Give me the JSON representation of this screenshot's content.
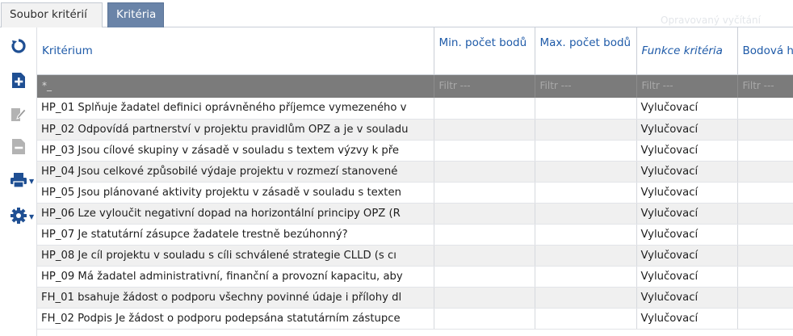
{
  "tabs": [
    {
      "label": "Soubor kritérií",
      "active": false
    },
    {
      "label": "Kritéria",
      "active": true
    }
  ],
  "tab_area_hint": "Opravovaný vyčítání",
  "toolbar": {
    "icons": [
      "refresh-icon",
      "add-document-icon",
      "edit-document-icon",
      "remove-document-icon",
      "print-icon",
      "settings-icon"
    ]
  },
  "colors": {
    "accent": "#1e5aa8",
    "active_tab": "#6a84a8",
    "filter_bar": "#7b7b7b",
    "row_alt": "#f0f0f0"
  },
  "table": {
    "columns": [
      "Kritérium",
      "Min. počet bodů",
      "Max. počet bodů",
      "Funkce kritéria",
      "Bodová h"
    ],
    "filter_placeholder": "Filtr ---",
    "first_filter_value": "*_",
    "rows": [
      [
        "HP_01 Splňuje žadatel definici oprávněného příjemce vymezeného v",
        "",
        "",
        "Vylučovací",
        ""
      ],
      [
        "HP_02 Odpovídá partnerství v projektu pravidlům OPZ a je v souladu",
        "",
        "",
        "Vylučovací",
        ""
      ],
      [
        "HP_03 Jsou cílové skupiny v zásadě v souladu s textem výzvy k pře",
        "",
        "",
        "Vylučovací",
        ""
      ],
      [
        "HP_04 Jsou celkové způsobilé výdaje projektu v rozmezí stanovené",
        "",
        "",
        "Vylučovací",
        ""
      ],
      [
        "HP_05 Jsou plánované aktivity projektu v zásadě v souladu s texten",
        "",
        "",
        "Vylučovací",
        ""
      ],
      [
        "HP_06 Lze vyloučit negativní dopad na horizontální principy OPZ (R",
        "",
        "",
        "Vylučovací",
        ""
      ],
      [
        "HP_07 Je statutární zásupce žadatele trestně bezúhonný?",
        "",
        "",
        "Vylučovací",
        ""
      ],
      [
        "HP_08 Je cíl projektu v souladu s cíli schválené strategie CLLD (s cı",
        "",
        "",
        "Vylučovací",
        ""
      ],
      [
        "HP_09 Má žadatel administrativní, finanční a provozní kapacitu, aby",
        "",
        "",
        "Vylučovací",
        ""
      ],
      [
        "FH_01 bsahuje žádost o podporu všechny povinné údaje i přílohy dl",
        "",
        "",
        "Vylučovací",
        ""
      ],
      [
        "FH_02 Podpis Je žádost o podporu podepsána statutárním zástupce",
        "",
        "",
        "Vylučovací",
        ""
      ]
    ]
  }
}
